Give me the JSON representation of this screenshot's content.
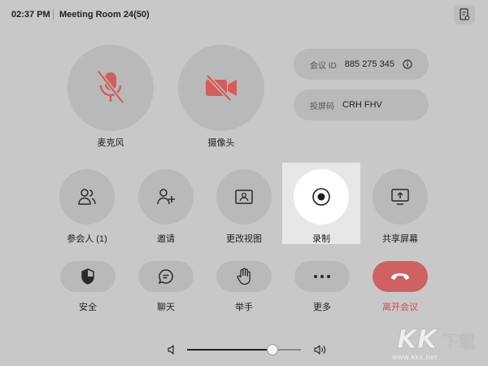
{
  "status_bar": {
    "time": "02:37 PM",
    "meeting_title": "Meeting Room 24(50)",
    "corner_icon": "device-info-icon"
  },
  "audio_video": {
    "mic_label": "麦克风",
    "mic_icon": "mic-off-icon",
    "camera_label": "摄像头",
    "camera_icon": "video-off-icon",
    "off_color": "#d65c5c"
  },
  "meeting_info": {
    "id_key": "会议 ID",
    "id_value": "885 275 345",
    "share_key": "投屏码",
    "share_value": "CRH FHV"
  },
  "controls": [
    {
      "label": "参会人 (1)",
      "icon": "participants-icon"
    },
    {
      "label": "邀请",
      "icon": "add-user-icon"
    },
    {
      "label": "更改视图",
      "icon": "view-layout-icon"
    },
    {
      "label": "录制",
      "icon": "record-icon",
      "highlighted": true
    },
    {
      "label": "共享屏幕",
      "icon": "share-screen-icon"
    }
  ],
  "actions": [
    {
      "label": "安全",
      "icon": "shield-icon"
    },
    {
      "label": "聊天",
      "icon": "chat-icon"
    },
    {
      "label": "举手",
      "icon": "raise-hand-icon"
    },
    {
      "label": "更多",
      "icon": "more-icon"
    },
    {
      "label": "离开会议",
      "icon": "hang-up-icon",
      "color": "#cf6161"
    }
  ],
  "volume": {
    "level": 0.75,
    "low_icon": "volume-low-icon",
    "high_icon": "volume-high-icon"
  },
  "watermark": {
    "logo": "KK下载",
    "url": "www.kkx.net"
  }
}
